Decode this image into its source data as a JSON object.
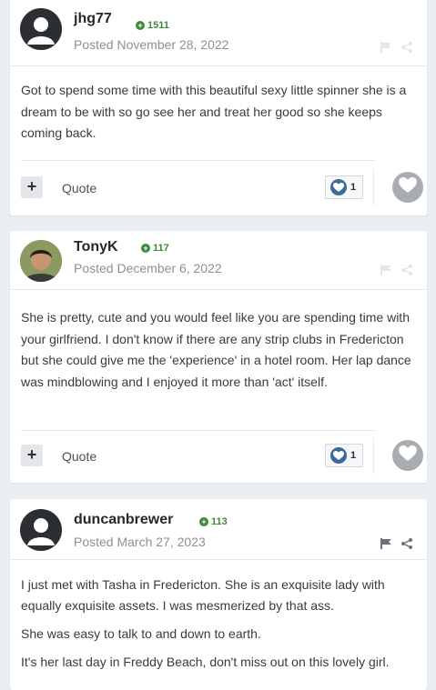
{
  "posts": [
    {
      "author": "jhg77",
      "reputation": "1511",
      "posted": "Posted November 28, 2022",
      "paragraphs": [
        "Got to spend some time with this beautiful sexy little spinner she is a dream  to be with so go see her and treat her good so she keeps coming back."
      ],
      "quote_label": "Quote",
      "reaction_count": "1",
      "avatar": "default-silhouette"
    },
    {
      "author": "TonyK",
      "reputation": "117",
      "posted": "Posted December 6, 2022",
      "paragraphs": [
        "She is pretty, cute and you would feel like you are spending time with your girlfriend. I don't know if there are any strip clubs in Fredericton but she could give me the 'experience' in a hotel room. Her lap dance was mindblowing and I enjoyed it more than 'act' itself."
      ],
      "quote_label": "Quote",
      "reaction_count": "1",
      "avatar": "photo"
    },
    {
      "author": "duncanbrewer",
      "reputation": "113",
      "posted": "Posted March 27, 2023",
      "paragraphs": [
        "I just met with Tasha in Fredericton. She is an exquisite lady with equally exquisite assets. I was mesmerized by that ass.",
        "She was easy to talk to and down to earth.",
        "It's her last day in Freddy Beach, don't miss out on this lovely girl."
      ],
      "avatar": "default-silhouette"
    }
  ],
  "icons": {
    "report": "flag-icon",
    "share": "share-icon",
    "reputation": "plus-circle-icon",
    "reaction": "heart-icon",
    "multiquote": "plus-icon"
  },
  "colors": {
    "reputation": "#3c8a3c",
    "reaction_badge": "#3c6b9b",
    "reaction_button": "#a9adb2",
    "background": "#ebeef2"
  }
}
